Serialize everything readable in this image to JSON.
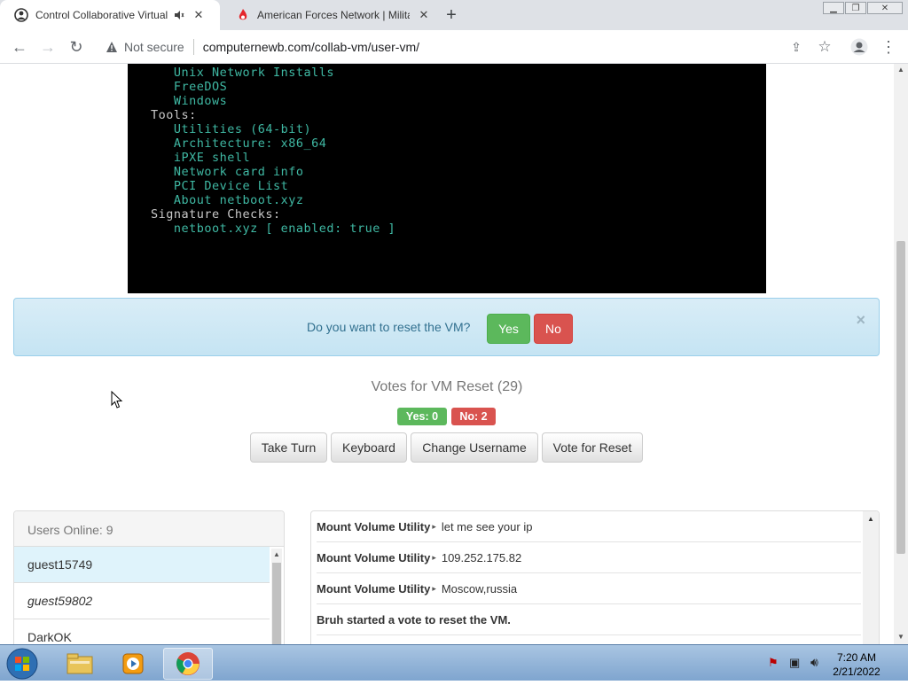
{
  "browser": {
    "tabs": [
      {
        "title": "Control Collaborative Virtual Machines",
        "active": true
      },
      {
        "title": "American Forces Network | Military News",
        "active": false
      }
    ],
    "new_tab_label": "+",
    "address": {
      "security": "Not secure",
      "url": "computernewb.com/collab-vm/user-vm/"
    }
  },
  "vm_screen": {
    "lines": [
      {
        "text": "   Unix Network Installs",
        "color": "green"
      },
      {
        "text": "   FreeDOS",
        "color": "green"
      },
      {
        "text": "   Windows",
        "color": "green"
      },
      {
        "text": "Tools:",
        "color": "white"
      },
      {
        "text": "   Utilities (64-bit)",
        "color": "green"
      },
      {
        "text": "   Architecture: x86_64",
        "color": "green"
      },
      {
        "text": "   iPXE shell",
        "color": "green"
      },
      {
        "text": "   Network card info",
        "color": "green"
      },
      {
        "text": "   PCI Device List",
        "color": "green"
      },
      {
        "text": "   About netboot.xyz",
        "color": "green"
      },
      {
        "text": "Signature Checks:",
        "color": "white"
      },
      {
        "text": "   netboot.xyz [ enabled: true ]",
        "color": "green"
      }
    ]
  },
  "reset_alert": {
    "question": "Do you want to reset the VM?",
    "yes": "Yes",
    "no": "No",
    "close": "×"
  },
  "votes": {
    "title": "Votes for VM Reset (29)",
    "yes": "Yes: 0",
    "no": "No: 2"
  },
  "actions": {
    "take_turn": "Take Turn",
    "keyboard": "Keyboard",
    "change_username": "Change Username",
    "vote_reset": "Vote for Reset"
  },
  "users": {
    "header": "Users Online: 9",
    "list": [
      "guest15749",
      "guest59802",
      "DarkOK"
    ]
  },
  "chat": {
    "messages": [
      {
        "user": "Mount Volume Utility",
        "text": "let me see your ip"
      },
      {
        "user": "Mount Volume Utility",
        "text": "109.252.175.82"
      },
      {
        "user": "Mount Volume Utility",
        "text": "Moscow,russia"
      }
    ],
    "system": "Bruh started a vote to reset the VM."
  },
  "taskbar": {
    "time": "7:20 AM",
    "date": "2/21/2022"
  },
  "colors": {
    "vm_green": "#3fb8a3",
    "success": "#5cb85c",
    "danger": "#d9534f",
    "info_bg": "#d9edf7"
  }
}
